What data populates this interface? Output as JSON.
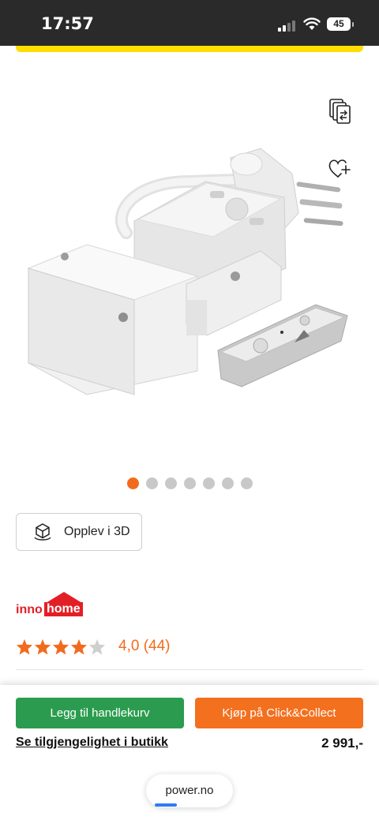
{
  "status_bar": {
    "time": "17:57",
    "battery": "45"
  },
  "product": {
    "image_alt": "innoHome remote controlled socket with plug and remote",
    "gallery": {
      "image_count": 7,
      "active_index": 0
    },
    "view_3d_label": "Opplev i 3D",
    "brand": {
      "part1": "inno",
      "part2": "home"
    },
    "rating": {
      "stars": 4,
      "max_stars": 5,
      "text": "4,0 (44)"
    }
  },
  "actions": {
    "add_to_cart": "Legg til handlekurv",
    "click_collect": "Kjøp på Click&Collect",
    "store_availability": "Se tilgjengelighet i butikk",
    "price": "2 991,-"
  },
  "browser": {
    "url": "power.no"
  },
  "colors": {
    "accent": "#f26b1d",
    "cart_green": "#2b9c4f",
    "banner_yellow": "#ffdd00",
    "brand_red": "#e31f26"
  },
  "icons": [
    "compare-icon",
    "heart-plus-icon",
    "cube-3d-icon",
    "star-icon",
    "wifi-icon",
    "battery-icon"
  ]
}
